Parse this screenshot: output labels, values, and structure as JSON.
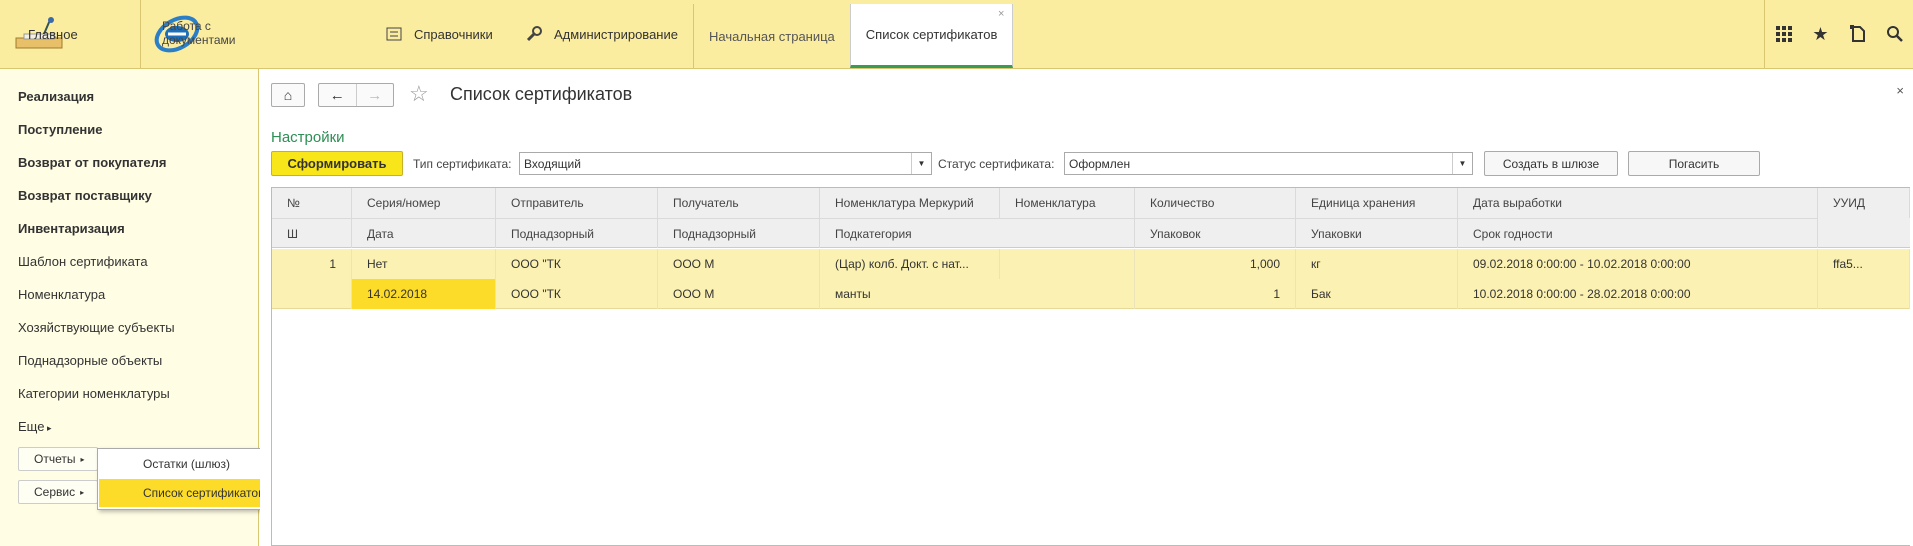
{
  "topbar": {
    "home_label": "Главное",
    "docs_label": "Работа с документами",
    "ref_label": "Справочники",
    "admin_label": "Администрирование",
    "tabs": [
      {
        "label": "Начальная страница"
      },
      {
        "label": "Список сертификатов",
        "close": "×"
      }
    ],
    "icons": [
      "grid-icon",
      "star-icon",
      "history-icon",
      "search-icon"
    ]
  },
  "sidebar": {
    "items": [
      {
        "label": "Реализация"
      },
      {
        "label": "Поступление"
      },
      {
        "label": "Возврат от покупателя"
      },
      {
        "label": "Возврат поставщику"
      },
      {
        "label": "Инвентаризация"
      },
      {
        "label": "Шаблон сертификата"
      },
      {
        "label": "Номенклатура"
      },
      {
        "label": "Хозяйствующие субъекты"
      },
      {
        "label": "Поднадзорные объекты"
      },
      {
        "label": "Категории номенклатуры"
      },
      {
        "label": "Еще"
      }
    ],
    "reports_label": "Отчеты",
    "service_label": "Сервис"
  },
  "popup": {
    "items": [
      {
        "label": "Остатки (шлюз)"
      },
      {
        "label": "Список сертификатов"
      }
    ]
  },
  "main": {
    "title": "Список сертификатов",
    "close": "×",
    "settings_link": "Настройки",
    "form_button": "Сформировать",
    "type_label": "Тип сертификата:",
    "type_value": "Входящий",
    "status_label": "Статус сертификата:",
    "status_value": "Оформлен",
    "create_button": "Создать в шлюзе",
    "repay_button": "Погасить"
  },
  "table": {
    "header_top": [
      "№",
      "Серия/номер",
      "Отправитель",
      "Получатель",
      "Номенклатура Меркурий",
      "Номенклатура",
      "Количество",
      "Единица хранения",
      "Дата выработки",
      "УУИД"
    ],
    "header_bottom": [
      "Ш",
      "Дата",
      "Поднадзорный",
      "Поднадзорный",
      "Подкатегория",
      "Упаковок",
      "Упаковки",
      "Срок годности"
    ],
    "rows": [
      {
        "top": [
          "1",
          "Нет",
          "ООО \"ТК",
          "ООО М",
          "(Цар) колб. Докт. с нат...",
          "",
          "1,000",
          "кг",
          "09.02.2018 0:00:00 - 10.02.2018 0:00:00",
          "ffa5..."
        ],
        "bottom": [
          "",
          "14.02.2018",
          "ООО \"ТК",
          "ООО М",
          "манты",
          "1",
          "Бак",
          "10.02.2018 0:00:00 - 28.02.2018 0:00:00"
        ]
      }
    ]
  }
}
